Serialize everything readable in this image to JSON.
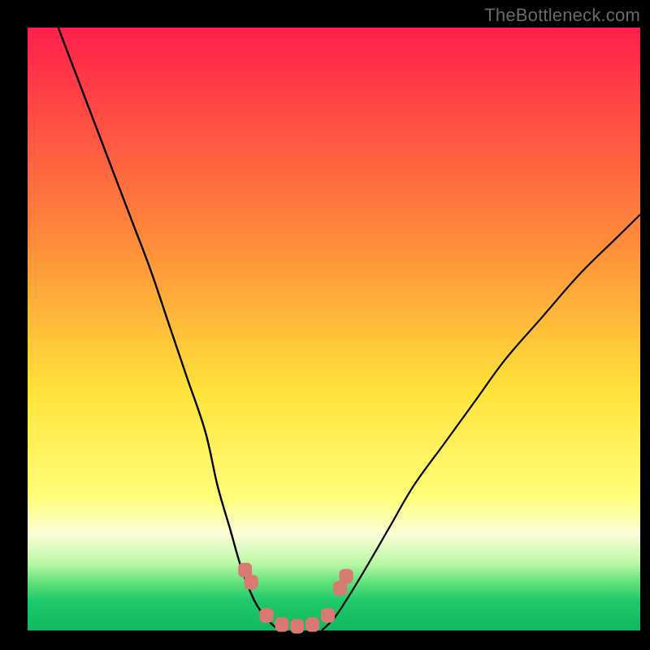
{
  "watermark": "TheBottleneck.com",
  "chart_data": {
    "type": "line",
    "title": "",
    "xlabel": "",
    "ylabel": "",
    "xlim": [
      0,
      100
    ],
    "ylim": [
      0,
      100
    ],
    "gradient_stops": [
      {
        "offset": 0,
        "color": "#ff1f4b"
      },
      {
        "offset": 35,
        "color": "#ff8a3a"
      },
      {
        "offset": 60,
        "color": "#ffe23a"
      },
      {
        "offset": 78,
        "color": "#ffff7a"
      },
      {
        "offset": 84,
        "color": "#fcfed8"
      },
      {
        "offset": 89,
        "color": "#b7f7a5"
      },
      {
        "offset": 92,
        "color": "#62e27a"
      },
      {
        "offset": 95,
        "color": "#20c96b"
      },
      {
        "offset": 100,
        "color": "#10b85f"
      }
    ],
    "series": [
      {
        "name": "left-curve",
        "type": "line",
        "points": [
          {
            "x": 5,
            "y": 100
          },
          {
            "x": 8,
            "y": 92
          },
          {
            "x": 11,
            "y": 84
          },
          {
            "x": 14,
            "y": 76
          },
          {
            "x": 17,
            "y": 68
          },
          {
            "x": 20,
            "y": 60
          },
          {
            "x": 23,
            "y": 51
          },
          {
            "x": 26,
            "y": 42
          },
          {
            "x": 29,
            "y": 33
          },
          {
            "x": 31,
            "y": 24
          },
          {
            "x": 33,
            "y": 17
          },
          {
            "x": 35,
            "y": 10
          },
          {
            "x": 37,
            "y": 5
          },
          {
            "x": 39,
            "y": 2
          },
          {
            "x": 41,
            "y": 0
          }
        ]
      },
      {
        "name": "right-curve",
        "type": "line",
        "points": [
          {
            "x": 48,
            "y": 0
          },
          {
            "x": 50,
            "y": 2
          },
          {
            "x": 52,
            "y": 5
          },
          {
            "x": 55,
            "y": 10
          },
          {
            "x": 59,
            "y": 17
          },
          {
            "x": 63,
            "y": 24
          },
          {
            "x": 68,
            "y": 31
          },
          {
            "x": 73,
            "y": 38
          },
          {
            "x": 78,
            "y": 45
          },
          {
            "x": 84,
            "y": 52
          },
          {
            "x": 90,
            "y": 59
          },
          {
            "x": 96,
            "y": 65
          },
          {
            "x": 100,
            "y": 69
          }
        ]
      },
      {
        "name": "valley-markers",
        "type": "scatter",
        "points": [
          {
            "x": 35.5,
            "y": 10
          },
          {
            "x": 36.5,
            "y": 8
          },
          {
            "x": 39,
            "y": 2.5
          },
          {
            "x": 41.5,
            "y": 1.0
          },
          {
            "x": 44,
            "y": 0.7
          },
          {
            "x": 46.5,
            "y": 1.0
          },
          {
            "x": 49,
            "y": 2.5
          },
          {
            "x": 51,
            "y": 7
          },
          {
            "x": 52,
            "y": 9
          }
        ]
      }
    ]
  }
}
